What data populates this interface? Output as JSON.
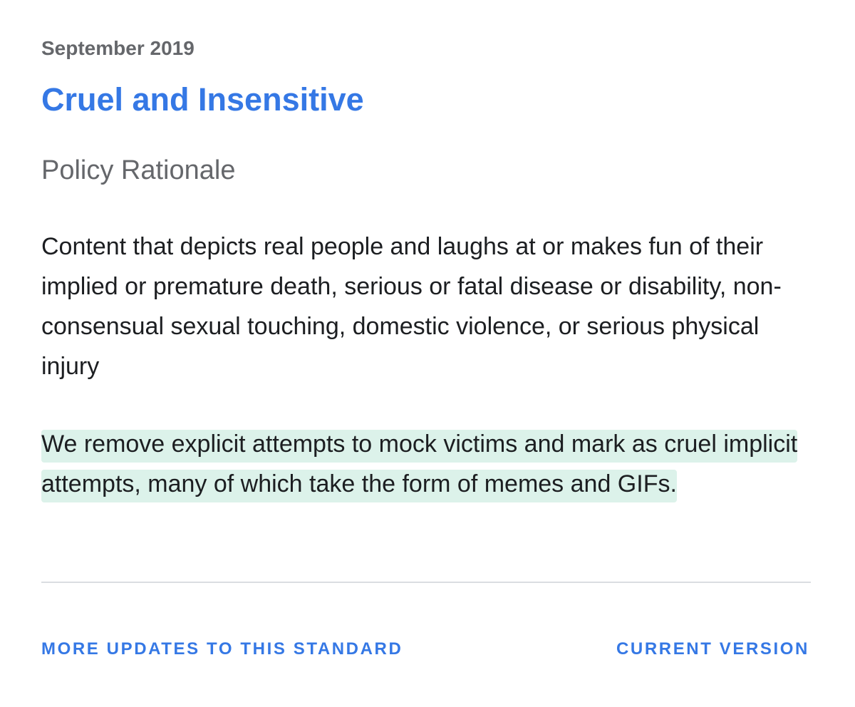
{
  "update": {
    "date": "September 2019",
    "title": "Cruel and Insensitive",
    "section_heading": "Policy Rationale",
    "paragraph_1": "Content that depicts real people and laughs at or makes fun of their implied or premature death, serious or fatal disease or disability, non-consensual sexual touching, domestic violence, or serious physical injury",
    "paragraph_2_highlighted": " We remove explicit attempts to mock victims and mark as cruel implicit attempts, many of which take the form of memes and GIFs. "
  },
  "footer": {
    "more_updates_label": "MORE UPDATES TO THIS STANDARD",
    "current_version_label": "CURRENT VERSION"
  },
  "colors": {
    "accent": "#3578e5",
    "muted_text": "#65676b",
    "body_text": "#1c1e21",
    "highlight": "#dcf2ea",
    "divider": "#dadde1"
  }
}
